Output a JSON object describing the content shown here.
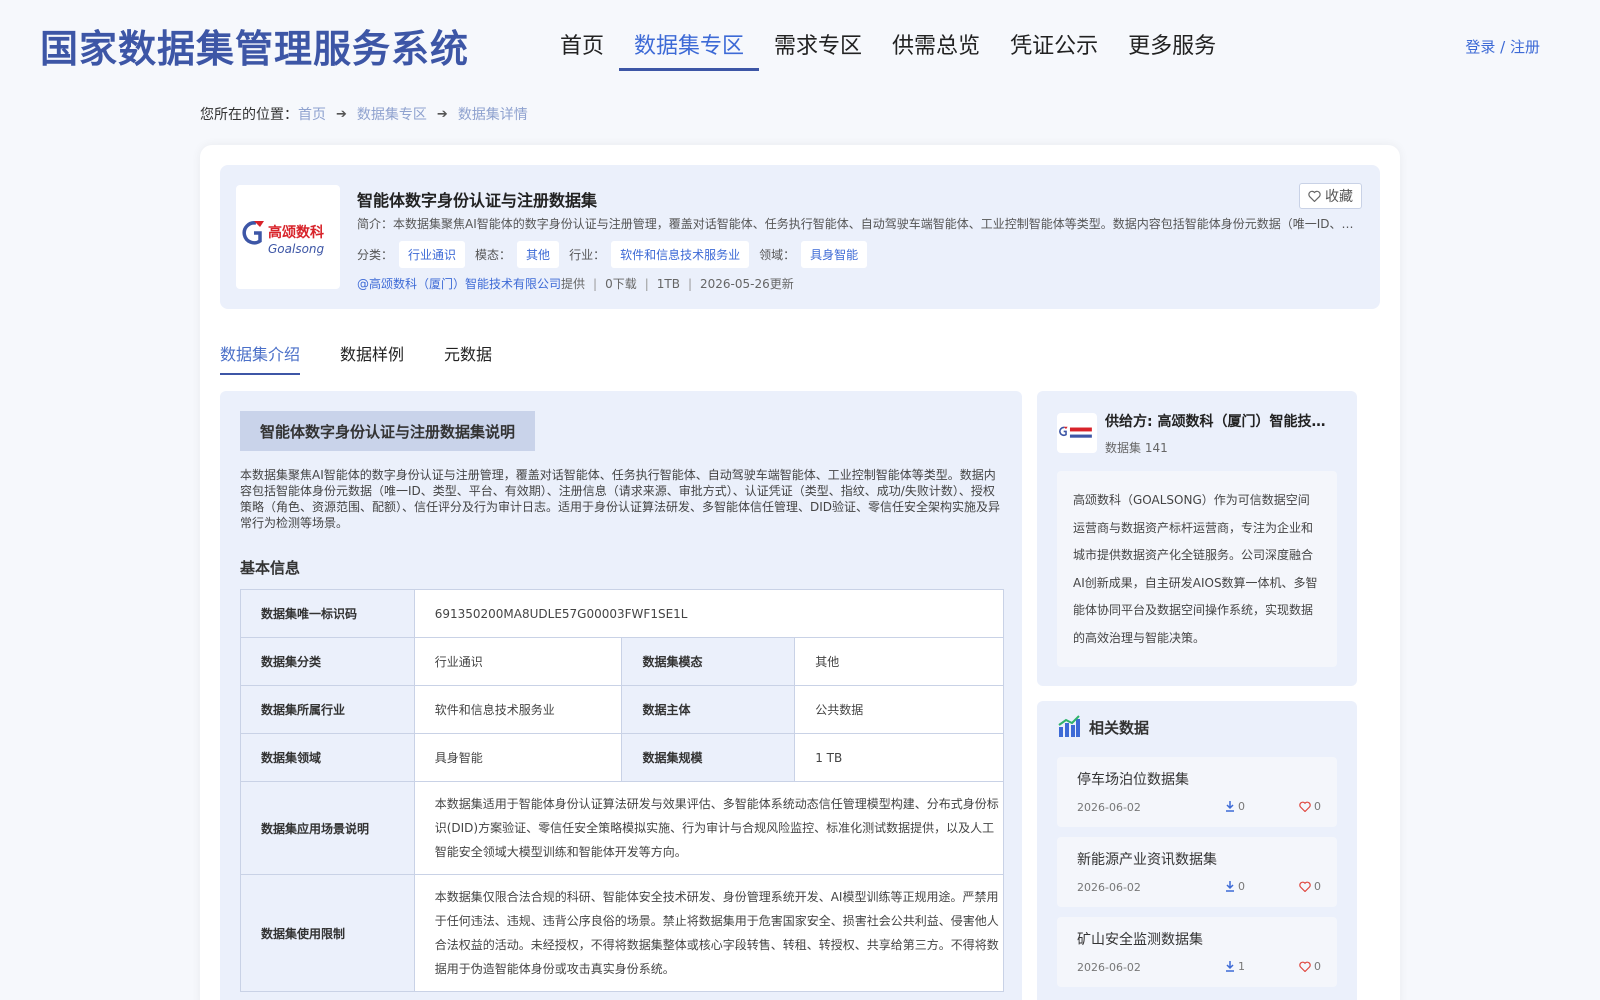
{
  "site": {
    "title": "国家数据集管理服务系统",
    "nav": [
      {
        "label": "首页"
      },
      {
        "label": "数据集专区",
        "active": true
      },
      {
        "label": "需求专区"
      },
      {
        "label": "供需总览"
      },
      {
        "label": "凭证公示"
      },
      {
        "label": "更多服务"
      }
    ],
    "login": "登录 / 注册"
  },
  "breadcrumb": {
    "prefix": "您所在的位置：",
    "items": [
      "首页",
      "数据集专区",
      "数据集详情"
    ]
  },
  "dataset": {
    "logo_cn": "高颂数科",
    "logo_en": "Goalsong",
    "title": "智能体数字身份认证与注册数据集",
    "favorite_label": "收藏",
    "intro": "简介：本数据集聚焦AI智能体的数字身份认证与注册管理，覆盖对话智能体、任务执行智能体、自动驾驶车端智能体、工业控制智能体等类型。数据内容包括智能体身份元数据（唯一ID、类型、平台、有效期）、注册信息（请求来源、审批方式）",
    "tags": {
      "category_label": "分类：",
      "category": "行业通识",
      "modality_label": "模态：",
      "modality": "其他",
      "industry_label": "行业：",
      "industry": "软件和信息技术服务业",
      "domain_label": "领域：",
      "domain": "具身智能"
    },
    "provider": "@高颂数科（厦门）智能技术有限公司",
    "provider_suffix": "提供",
    "downloads": "0下载",
    "size": "1TB",
    "updated": "2026-05-26更新"
  },
  "tabs": [
    {
      "label": "数据集介绍",
      "active": true
    },
    {
      "label": "数据样例"
    },
    {
      "label": "元数据"
    }
  ],
  "detail": {
    "section_title": "智能体数字身份认证与注册数据集说明",
    "description": "本数据集聚焦AI智能体的数字身份认证与注册管理，覆盖对话智能体、任务执行智能体、自动驾驶车端智能体、工业控制智能体等类型。数据内容包括智能体身份元数据（唯一ID、类型、平台、有效期）、注册信息（请求来源、审批方式）、认证凭证（类型、指纹、成功/失败计数）、授权策略（角色、资源范围、配额）、信任评分及行为审计日志。适用于身份认证算法研发、多智能体信任管理、DID验证、零信任安全架构实施及异常行为检测等场景。",
    "basic_info_title": "基本信息",
    "table": {
      "id_label": "数据集唯一标识码",
      "id_value": "691350200MA8UDLE57G00003FWF1SE1L",
      "category_label": "数据集分类",
      "category_value": "行业通识",
      "modality_label": "数据集模态",
      "modality_value": "其他",
      "industry_label": "数据集所属行业",
      "industry_value": "软件和信息技术服务业",
      "subject_label": "数据主体",
      "subject_value": "公共数据",
      "domain_label": "数据集领域",
      "domain_value": "具身智能",
      "scale_label": "数据集规模",
      "scale_value": "1 TB",
      "scenario_label": "数据集应用场景说明",
      "scenario_value": "本数据集适用于智能体身份认证算法研发与效果评估、多智能体系统动态信任管理模型构建、分布式身份标识(DID)方案验证、零信任安全策略模拟实施、行为审计与合规风险监控、标准化测试数据提供，以及人工智能安全领域大模型训练和智能体开发等方向。",
      "restriction_label": "数据集使用限制",
      "restriction_value": "本数据集仅限合法合规的科研、智能体安全技术研发、身份管理系统开发、AI模型训练等正规用途。严禁用于任何违法、违规、违背公序良俗的场景。禁止将数据集用于危害国家安全、损害社会公共利益、侵害他人合法权益的活动。未经授权，不得将数据集整体或核心字段转售、转租、转授权、共享给第三方。不得将数据用于伪造智能体身份或攻击真实身份系统。"
    }
  },
  "supplier": {
    "name": "供给方: 高颂数科（厦门）智能技术有限公司",
    "count": "数据集 141",
    "description": "高颂数科（GOALSONG）作为可信数据空间运营商与数据资产标杆运营商，专注为企业和城市提供数据资产化全链服务。公司深度融合AI创新成果，自主研发AIOS数算一体机、多智能体协同平台及数据空间操作系统，实现数据的高效治理与智能决策。"
  },
  "related": {
    "title": "相关数据",
    "items": [
      {
        "name": "停车场泊位数据集",
        "date": "2026-06-02",
        "downloads": "0",
        "likes": "0"
      },
      {
        "name": "新能源产业资讯数据集",
        "date": "2026-06-02",
        "downloads": "0",
        "likes": "0"
      },
      {
        "name": "矿山安全监测数据集",
        "date": "2026-06-02",
        "downloads": "1",
        "likes": "0"
      }
    ]
  },
  "colors": {
    "brand": "#3d56a6",
    "accent": "#3d6ad6",
    "panel_bg": "#ebf0fb"
  }
}
